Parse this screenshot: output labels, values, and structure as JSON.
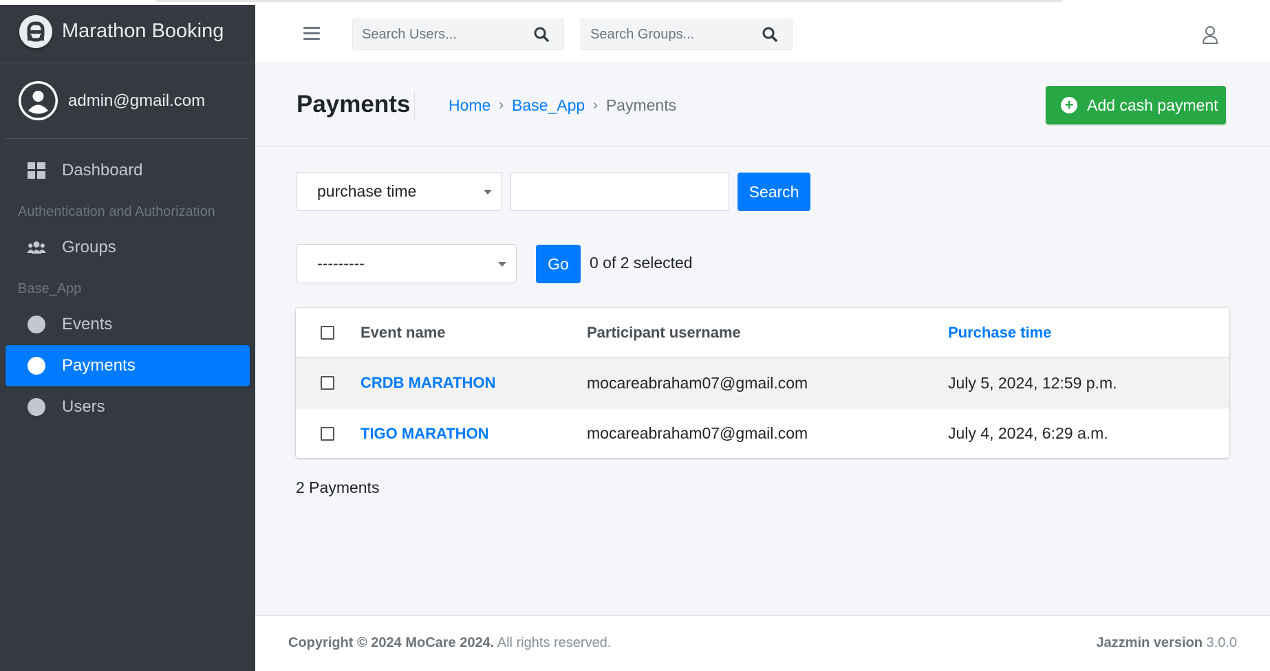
{
  "brand": {
    "name": "Marathon Booking"
  },
  "user": {
    "email": "admin@gmail.com"
  },
  "sidebar": {
    "dashboard": "Dashboard",
    "auth_header": "Authentication and Authorization",
    "groups": "Groups",
    "app_header": "Base_App",
    "events": "Events",
    "payments": "Payments",
    "users": "Users"
  },
  "topbar": {
    "search_users_placeholder": "Search Users...",
    "search_groups_placeholder": "Search Groups..."
  },
  "header": {
    "title": "Payments",
    "breadcrumb": [
      "Home",
      "Base_App",
      "Payments"
    ],
    "breadcrumb_sep": "›",
    "add_button": "Add cash payment"
  },
  "filters": {
    "field_select": "purchase time",
    "search_value": "",
    "search_button": "Search",
    "action_select": "---------",
    "go_button": "Go",
    "selected_text": "0 of 2 selected"
  },
  "table": {
    "columns": [
      "Event name",
      "Participant username",
      "Purchase time"
    ],
    "rows": [
      {
        "event": "CRDB MARATHON",
        "participant": "mocareabraham07@gmail.com",
        "time": "July 5, 2024, 12:59 p.m."
      },
      {
        "event": "TIGO MARATHON",
        "participant": "mocareabraham07@gmail.com",
        "time": "July 4, 2024, 6:29 a.m."
      }
    ]
  },
  "summary": "2 Payments",
  "footer": {
    "copyright_bold": "Copyright © 2024 MoCare 2024.",
    "copyright_rest": " All rights reserved.",
    "version_label": "Jazzmin version",
    "version": " 3.0.0"
  },
  "colors": {
    "primary": "#007bff",
    "success": "#28a745",
    "sidebar": "#343a40"
  }
}
